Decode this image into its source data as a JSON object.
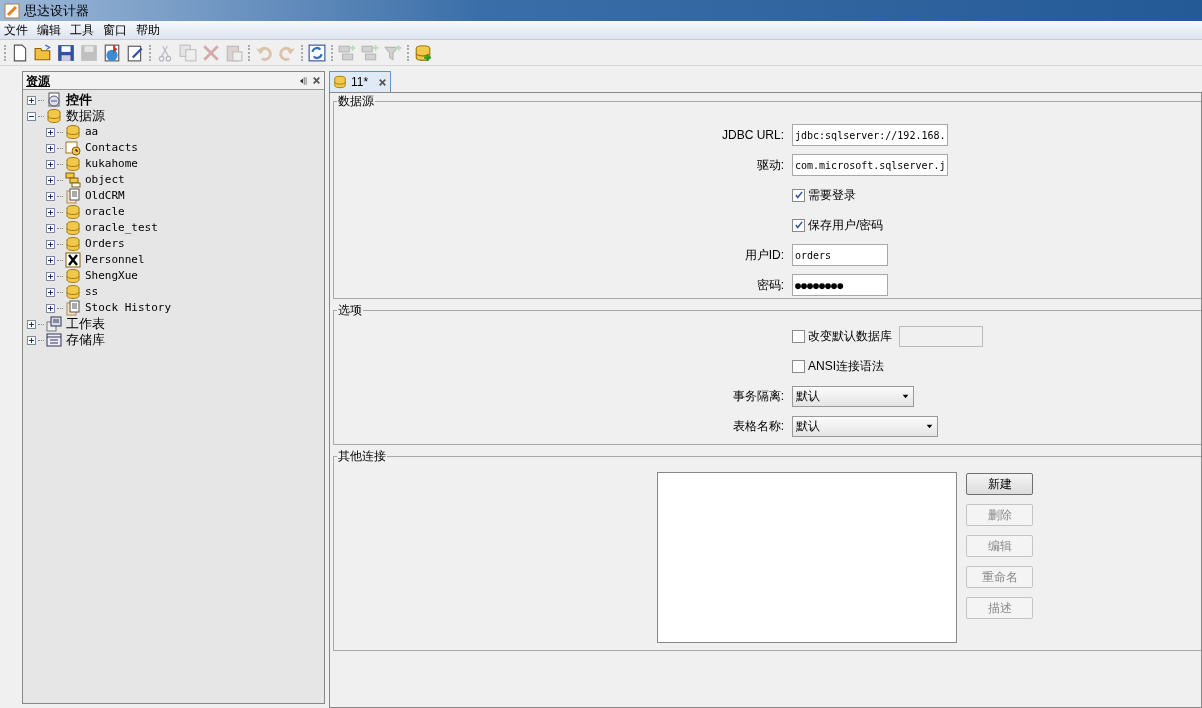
{
  "window": {
    "title": "思达设计器"
  },
  "menu": [
    "文件",
    "编辑",
    "工具",
    "窗口",
    "帮助"
  ],
  "toolbar": [
    [
      {
        "kind": "new",
        "disabled": false
      },
      {
        "kind": "open",
        "disabled": false
      },
      {
        "kind": "save",
        "disabled": false
      },
      {
        "kind": "save-all",
        "disabled": true
      },
      {
        "kind": "publish",
        "disabled": false
      },
      {
        "kind": "edit",
        "disabled": false
      }
    ],
    [
      {
        "kind": "cut",
        "disabled": true
      },
      {
        "kind": "copy",
        "disabled": true
      },
      {
        "kind": "delete",
        "disabled": true
      },
      {
        "kind": "paste",
        "disabled": true
      }
    ],
    [
      {
        "kind": "undo",
        "disabled": true
      },
      {
        "kind": "redo",
        "disabled": true
      }
    ],
    [
      {
        "kind": "refresh",
        "disabled": false
      }
    ],
    [
      {
        "kind": "add-node",
        "disabled": true
      },
      {
        "kind": "add-node",
        "disabled": true
      },
      {
        "kind": "add-filter",
        "disabled": true
      }
    ],
    [
      {
        "kind": "add-db",
        "disabled": false
      }
    ]
  ],
  "resource_panel": {
    "title": "资源",
    "tree": [
      {
        "label": "控件",
        "kind": "controls",
        "expanded": false,
        "bold": true
      },
      {
        "label": "数据源",
        "kind": "database",
        "expanded": true,
        "bold": false,
        "children": [
          {
            "label": "aa",
            "kind": "database",
            "expanded": false
          },
          {
            "label": "Contacts",
            "kind": "contacts",
            "expanded": false
          },
          {
            "label": "kukahome",
            "kind": "database",
            "expanded": false
          },
          {
            "label": "object",
            "kind": "object",
            "expanded": false
          },
          {
            "label": "OldCRM",
            "kind": "document",
            "expanded": false
          },
          {
            "label": "oracle",
            "kind": "database",
            "expanded": false
          },
          {
            "label": "oracle_test",
            "kind": "database",
            "expanded": false
          },
          {
            "label": "Orders",
            "kind": "database",
            "expanded": false
          },
          {
            "label": "Personnel",
            "kind": "excel",
            "expanded": false
          },
          {
            "label": "ShengXue",
            "kind": "database",
            "expanded": false
          },
          {
            "label": "ss",
            "kind": "database",
            "expanded": false
          },
          {
            "label": "Stock History",
            "kind": "document",
            "expanded": false
          }
        ]
      },
      {
        "label": "工作表",
        "kind": "worksheet",
        "expanded": false,
        "bold": false
      },
      {
        "label": "存储库",
        "kind": "repository",
        "expanded": false,
        "bold": false
      }
    ]
  },
  "editor_tab": {
    "label": "11*",
    "selected": true
  },
  "datasource_section": {
    "title": "数据源",
    "rows": [
      {
        "kind": "text",
        "label": "JDBC URL:",
        "value": "jdbc:sqlserver://192.168."
      },
      {
        "kind": "text",
        "label": "驱动:",
        "value": "com.microsoft.sqlserver.j"
      },
      {
        "kind": "checkbox",
        "label": "需要登录",
        "checked": true
      },
      {
        "kind": "checkbox",
        "label": "保存用户/密码",
        "checked": true
      },
      {
        "kind": "short-text",
        "label": "用户ID:",
        "value": "orders"
      },
      {
        "kind": "short-text",
        "label": "密码:",
        "value": "●●●●●●●●"
      }
    ]
  },
  "options_section": {
    "title": "选项",
    "rows": [
      {
        "kind": "checkbox-field",
        "label": "改变默认数据库",
        "checked": false
      },
      {
        "kind": "checkbox",
        "label": "ANSI连接语法",
        "checked": false
      },
      {
        "kind": "dropdown",
        "label": "事务隔离:",
        "value": "默认"
      },
      {
        "kind": "wide-dropdown",
        "label": "表格名称:",
        "value": "默认"
      }
    ]
  },
  "other_connections": {
    "title": "其他连接",
    "buttons": [
      {
        "label": "新建",
        "disabled": false
      },
      {
        "label": "删除",
        "disabled": true
      },
      {
        "label": "编辑",
        "disabled": true
      },
      {
        "label": "重命名",
        "disabled": true
      },
      {
        "label": "描述",
        "disabled": true
      }
    ]
  }
}
